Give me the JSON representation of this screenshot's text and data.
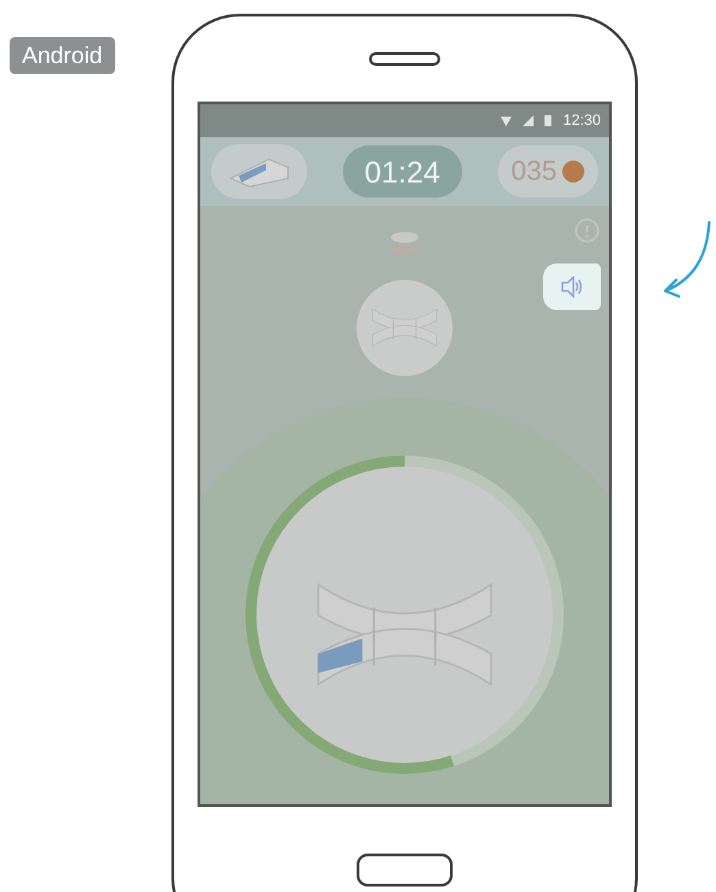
{
  "platform_badge": "Android",
  "status_bar": {
    "time": "12:30"
  },
  "top_bar": {
    "timer": "01:24",
    "coins": "035"
  },
  "progress_ring": {
    "level": 0.55
  },
  "sound_button": {
    "highlighted": true
  }
}
